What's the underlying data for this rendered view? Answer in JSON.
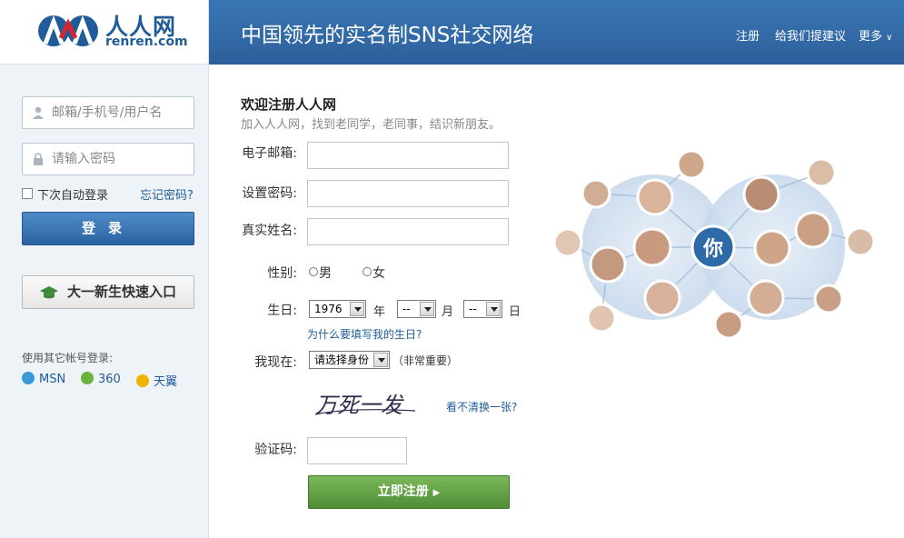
{
  "brand": {
    "logo_cn": "人人网",
    "logo_en": "renren.com"
  },
  "header": {
    "slogan": "中国领先的实名制SNS社交网络",
    "nav": {
      "register": "注册",
      "feedback": "给我们提建议",
      "more": "更多"
    }
  },
  "sidebar": {
    "email_placeholder": "邮箱/手机号/用户名",
    "password_placeholder": "请输入密码",
    "remember_label": "下次自动登录",
    "forgot_label": "忘记密码?",
    "login_label": "登录",
    "freshman_label": "大一新生快速入口",
    "other_login_label": "使用其它帐号登录:",
    "oauth": [
      {
        "label": "MSN",
        "color": "#3a9ad9"
      },
      {
        "label": "360",
        "color": "#6bb33a"
      },
      {
        "label": "天翼",
        "color": "#f0b400"
      }
    ]
  },
  "form": {
    "title": "欢迎注册人人网",
    "subtitle": "加入人人网，找到老同学，老同事，结识新朋友。",
    "email_label": "电子邮箱:",
    "password_label": "设置密码:",
    "name_label": "真实姓名:",
    "gender_label": "性别:",
    "gender_male": "男",
    "gender_female": "女",
    "birthday_label": "生日:",
    "year_value": "1976",
    "year_unit": "年",
    "month_value": "--",
    "month_unit": "月",
    "day_value": "--",
    "day_unit": "日",
    "birthday_why": "为什么要填写我的生日?",
    "status_label": "我现在:",
    "status_value": "请选择身份",
    "status_hint": "（非常重要）",
    "captcha_text": "万死一发",
    "captcha_refresh": "看不清换一张?",
    "captcha_label": "验证码:",
    "submit_label": "立即注册"
  },
  "illustration": {
    "center_label": "你"
  },
  "colors": {
    "brand_blue": "#1f5c99",
    "header_blue": "#3a75b4",
    "submit_green": "#5c9c40"
  }
}
